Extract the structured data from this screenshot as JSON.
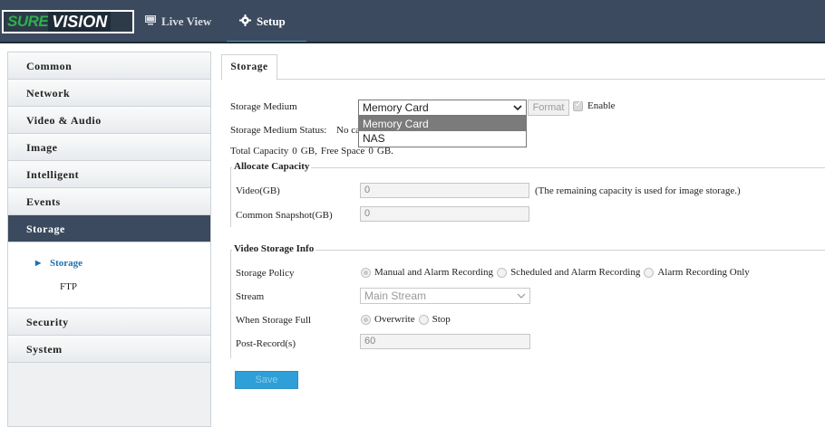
{
  "app": {
    "logo_part1": "SURE",
    "logo_part2": "VISION"
  },
  "topnav": {
    "live_view": "Live View",
    "setup": "Setup"
  },
  "sidebar": {
    "items": [
      "Common",
      "Network",
      "Video & Audio",
      "Image",
      "Intelligent",
      "Events",
      "Storage",
      "Security",
      "System"
    ],
    "sub_items": [
      "Storage",
      "FTP"
    ]
  },
  "tab": {
    "label": "Storage"
  },
  "form": {
    "storage_medium_label": "Storage Medium",
    "storage_medium_value": "Memory Card",
    "storage_medium_options": [
      "Memory Card",
      "NAS"
    ],
    "format_button": "Format",
    "enable_label": "Enable",
    "status_label": "Storage Medium Status:",
    "status_value": "No ca",
    "capacity_text_1": "Total Capacity",
    "total_capacity": "0",
    "capacity_unit_1": "GB,",
    "capacity_text_2": "Free Space",
    "free_space": "0",
    "capacity_unit_2": "GB."
  },
  "allocate": {
    "legend": "Allocate Capacity",
    "video_label": "Video(GB)",
    "video_value": "0",
    "video_note": "(The remaining capacity is used for image storage.)",
    "snapshot_label": "Common Snapshot(GB)",
    "snapshot_value": "0"
  },
  "video_info": {
    "legend": "Video Storage Info",
    "policy_label": "Storage Policy",
    "policy_options": [
      "Manual and Alarm Recording",
      "Scheduled and Alarm Recording",
      "Alarm Recording Only"
    ],
    "stream_label": "Stream",
    "stream_value": "Main Stream",
    "full_label": "When Storage Full",
    "full_options": [
      "Overwrite",
      "Stop"
    ],
    "post_record_label": "Post-Record(s)",
    "post_record_value": "60"
  },
  "save_button": "Save",
  "colors": {
    "topbar": "#3b4a5e",
    "accent_blue": "#2f9fd8",
    "logo_green": "#2fae4e"
  }
}
